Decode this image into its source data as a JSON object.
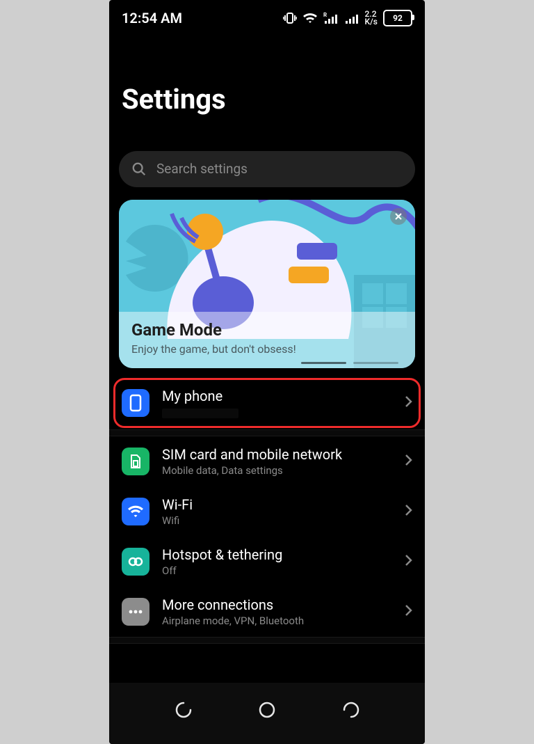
{
  "status": {
    "time": "12:54 AM",
    "net_rate": "2.2",
    "net_unit": "K/s",
    "battery": "92"
  },
  "page": {
    "title": "Settings",
    "search_placeholder": "Search settings"
  },
  "promo": {
    "title": "Game Mode",
    "subtitle": "Enjoy the game, but don't obsess!"
  },
  "items": {
    "my_phone": {
      "title": "My phone"
    },
    "sim": {
      "title": "SIM card and mobile network",
      "sub": "Mobile data, Data settings"
    },
    "wifi": {
      "title": "Wi-Fi",
      "sub": "Wifi"
    },
    "hotspot": {
      "title": "Hotspot & tethering",
      "sub": "Off"
    },
    "more": {
      "title": "More connections",
      "sub": "Airplane mode, VPN, Bluetooth"
    }
  }
}
